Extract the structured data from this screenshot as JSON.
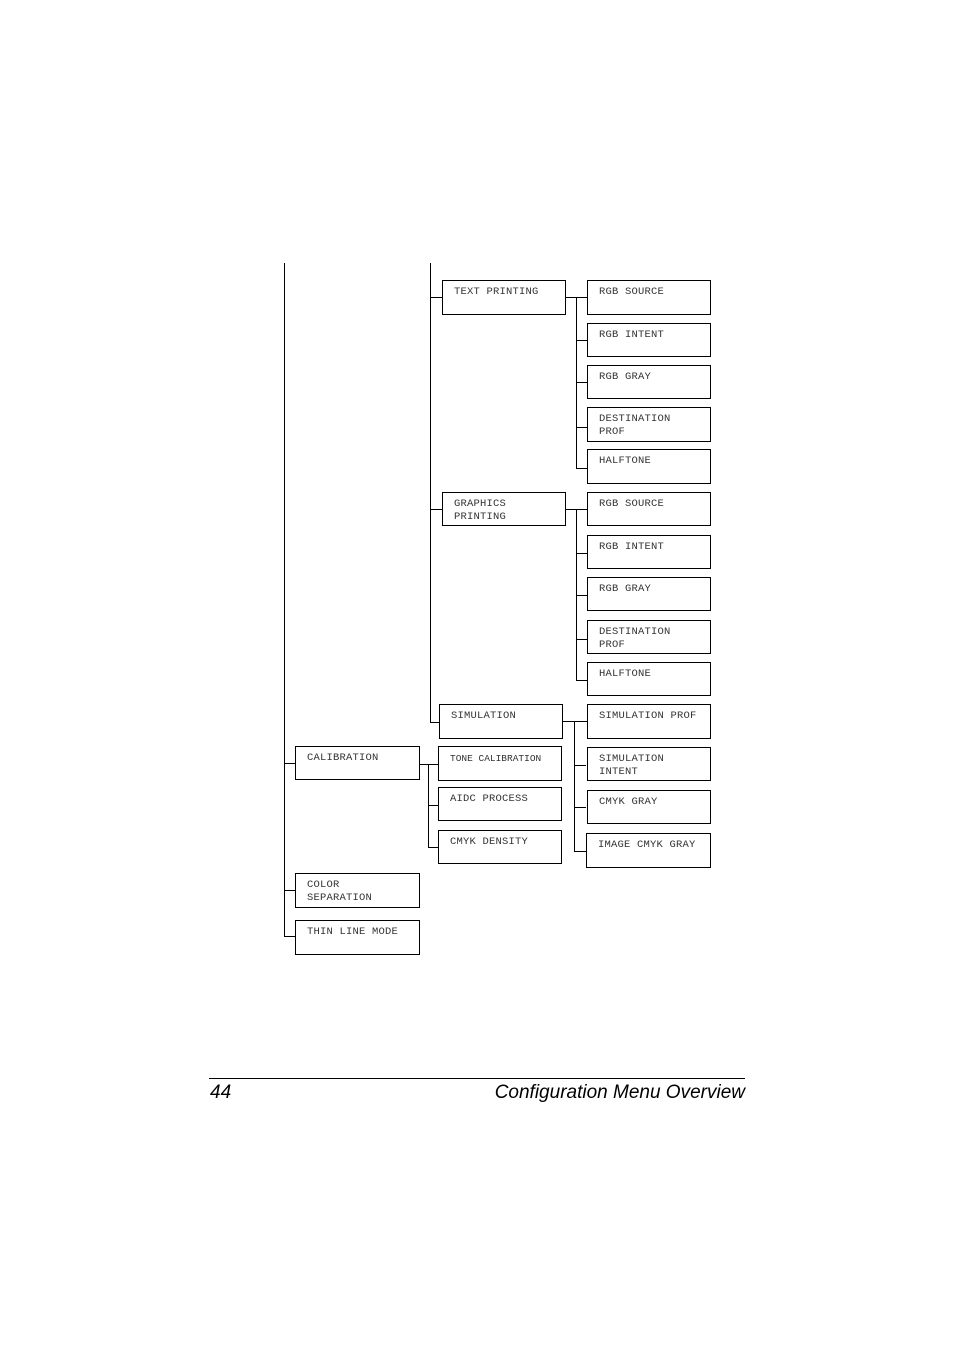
{
  "diagram": {
    "level1": {
      "calibration": "CALIBRATION",
      "color_separation": "COLOR\nSEPARATION",
      "thin_line_mode": "THIN LINE MODE"
    },
    "level2": {
      "text_printing": "TEXT PRINTING",
      "graphics_printing": "GRAPHICS\nPRINTING",
      "simulation": "SIMULATION",
      "tone_calibration": "TONE CALIBRATION",
      "aidc_process": "AIDC PROCESS",
      "cmyk_density": "CMYK DENSITY"
    },
    "text_printing_children": [
      "RGB SOURCE",
      "RGB INTENT",
      "RGB GRAY",
      "DESTINATION\nPROF",
      "HALFTONE"
    ],
    "graphics_printing_children": [
      "RGB SOURCE",
      "RGB INTENT",
      "RGB GRAY",
      "DESTINATION\nPROF",
      "HALFTONE"
    ],
    "simulation_children": [
      "SIMULATION PROF",
      "SIMULATION\nINTENT",
      "CMYK GRAY",
      "IMAGE CMYK GRAY"
    ]
  },
  "footer": {
    "page_number": "44",
    "section_title": "Configuration Menu Overview"
  }
}
